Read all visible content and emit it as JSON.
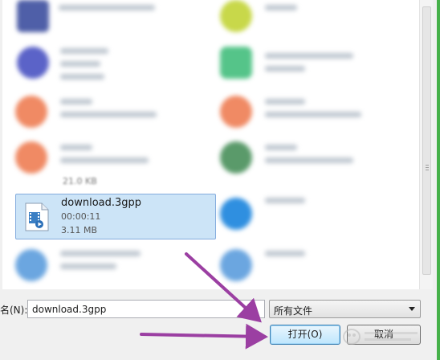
{
  "file_list": {
    "selected_file": {
      "name": "download.3gpp",
      "duration": "00:00:11",
      "size": "3.11 MB"
    },
    "previous_item_size": "21.0 KB"
  },
  "filename_field": {
    "label": "名(N):",
    "value": "download.3gpp"
  },
  "filetype_select": {
    "value": "所有文件"
  },
  "buttons": {
    "open": "打开(O)",
    "cancel": "取消"
  },
  "annotations": {
    "arrow_color": "#9b3fa2",
    "arrow_count": 2
  },
  "colors": {
    "selection": "#cce4f7",
    "selection_border": "#84acdd",
    "window_border": "#46b14a"
  }
}
